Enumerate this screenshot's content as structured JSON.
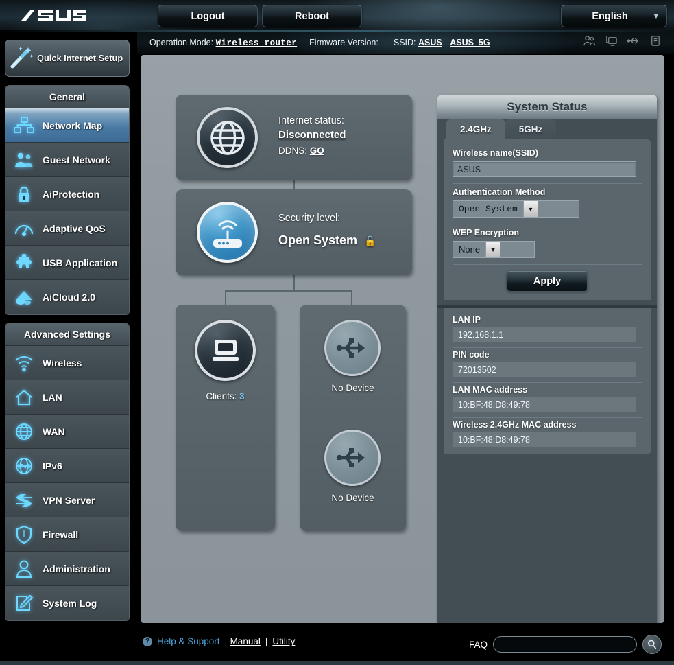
{
  "header": {
    "logo": "/SUS",
    "logout_label": "Logout",
    "reboot_label": "Reboot",
    "language": "English",
    "caret": "▼"
  },
  "infobar": {
    "operation_mode_label": "Operation Mode:",
    "operation_mode_value": "Wireless router",
    "firmware_label": "Firmware Version:",
    "firmware_value": "",
    "ssid_label": "SSID:",
    "ssid_1": "ASUS",
    "ssid_2": "ASUS_5G",
    "icons": [
      "clients-icon",
      "screen-icon",
      "usb-icon",
      "syslog-icon"
    ]
  },
  "sidebar": {
    "quick_setup": "Quick Internet Setup",
    "general_header": "General",
    "general_items": [
      {
        "label": "Network Map",
        "icon": "network-map-icon",
        "active": true
      },
      {
        "label": "Guest Network",
        "icon": "guest-network-icon",
        "active": false
      },
      {
        "label": "AiProtection",
        "icon": "lock-icon",
        "active": false
      },
      {
        "label": "Adaptive QoS",
        "icon": "gauge-icon",
        "active": false
      },
      {
        "label": "USB Application",
        "icon": "puzzle-icon",
        "active": false
      },
      {
        "label": "AiCloud 2.0",
        "icon": "cloud-icon",
        "active": false
      }
    ],
    "advanced_header": "Advanced Settings",
    "advanced_items": [
      {
        "label": "Wireless",
        "icon": "wifi-icon"
      },
      {
        "label": "LAN",
        "icon": "home-icon"
      },
      {
        "label": "WAN",
        "icon": "globe-icon"
      },
      {
        "label": "IPv6",
        "icon": "ipv6-globe-icon"
      },
      {
        "label": "VPN Server",
        "icon": "vpn-arrows-icon"
      },
      {
        "label": "Firewall",
        "icon": "shield-icon"
      },
      {
        "label": "Administration",
        "icon": "user-icon"
      },
      {
        "label": "System Log",
        "icon": "pencil-note-icon"
      }
    ]
  },
  "network_map": {
    "internet": {
      "status_label": "Internet status:",
      "status_value": "Disconnected",
      "ddns_label": "DDNS:",
      "ddns_action": "GO",
      "icon": "globe-icon"
    },
    "security": {
      "label": "Security level:",
      "value": "Open System",
      "lock_glyph": "🔓",
      "icon": "router-icon"
    },
    "clients": {
      "caption_label": "Clients:",
      "count": "3",
      "icon": "monitor-icon"
    },
    "usb_devices": [
      {
        "caption": "No Device",
        "icon": "usb-icon"
      },
      {
        "caption": "No Device",
        "icon": "usb-icon"
      }
    ]
  },
  "system_status": {
    "title": "System Status",
    "tabs": [
      {
        "label": "2.4GHz",
        "active": true
      },
      {
        "label": "5GHz",
        "active": false
      }
    ],
    "ssid_label": "Wireless name(SSID)",
    "ssid_value": "ASUS",
    "auth_label": "Authentication Method",
    "auth_value": "Open System",
    "auth_options": [
      "Open System"
    ],
    "wep_label": "WEP Encryption",
    "wep_value": "None",
    "wep_options": [
      "None"
    ],
    "apply_label": "Apply",
    "info_rows": [
      {
        "label": "LAN IP",
        "value": "192.168.1.1"
      },
      {
        "label": "PIN code",
        "value": "72013502"
      },
      {
        "label": "LAN MAC address",
        "value": "10:BF:48:D8:49:78"
      },
      {
        "label": "Wireless 2.4GHz MAC address",
        "value": "10:BF:48:D8:49:78"
      }
    ]
  },
  "footer": {
    "help_label": "Help & Support",
    "manual_label": "Manual",
    "separator": "|",
    "utility_label": "Utility",
    "faq_label": "FAQ",
    "faq_placeholder": "",
    "faq_value": "",
    "search_icon": "search-icon"
  },
  "colors": {
    "accent_blue": "#4a7ba5",
    "link_blue": "#4ea3db",
    "panel_dark": "#424e53",
    "main_bg": "#8e989e",
    "count_blue": "#7fc1ec"
  }
}
